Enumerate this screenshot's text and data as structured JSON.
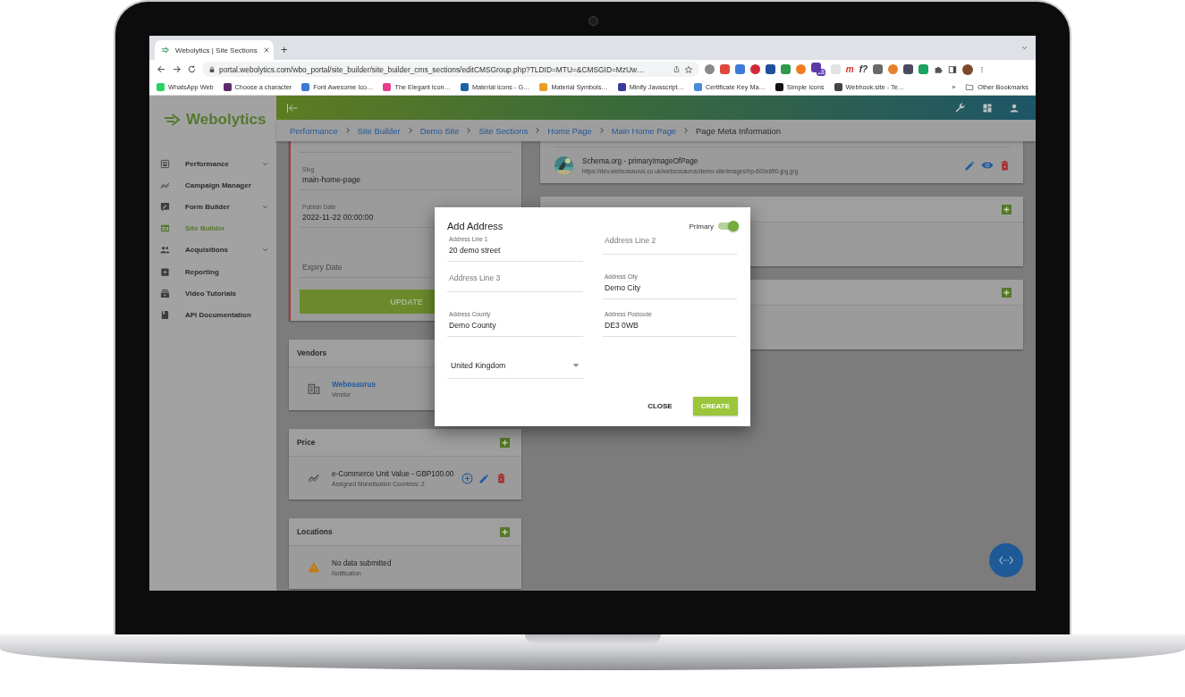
{
  "browser": {
    "tab": {
      "title": "Webolytics | Site Sections"
    },
    "new_tab": "+",
    "url": "portal.webolytics.com/wbo_portal/site_builder/site_builder_cms_sections/editCMSGroup.php?TLDID=MTU=&CMSGID=MzUw…",
    "extensions": [
      {
        "kind": "icon",
        "color": "#8a8a8a"
      },
      {
        "kind": "icon",
        "color": "#e0463c"
      },
      {
        "kind": "icon",
        "color": "#3b7bd6"
      },
      {
        "kind": "icon",
        "color": "#d2283a"
      },
      {
        "kind": "icon",
        "color": "#1f4f9a"
      },
      {
        "kind": "icon",
        "color": "#2e9a4a"
      },
      {
        "kind": "icon",
        "color": "#f07a22"
      },
      {
        "kind": "badge",
        "color": "#5b3aa8",
        "badge": "18"
      },
      {
        "kind": "icon",
        "color": "#e2e2e2"
      },
      {
        "kind": "text",
        "color": "#d8302c",
        "text": "m"
      },
      {
        "kind": "text",
        "color": "#333333",
        "text": "f?"
      },
      {
        "kind": "icon",
        "color": "#6a6a6a"
      },
      {
        "kind": "icon",
        "color": "#e8822a"
      },
      {
        "kind": "icon",
        "color": "#4a4a60"
      },
      {
        "kind": "icon",
        "color": "#1aa260"
      }
    ],
    "bookmarks": [
      {
        "label": "WhatsApp Web",
        "color": "#25d366"
      },
      {
        "label": "Choose a character",
        "color": "#5a2a6a"
      },
      {
        "label": "Font Awesome Ico…",
        "color": "#3b7bd6"
      },
      {
        "label": "The Elegant Icon…",
        "color": "#e83e8c"
      },
      {
        "label": "Material icons - G…",
        "color": "#1f5fa8"
      },
      {
        "label": "Material Symbols…",
        "color": "#e8a020"
      },
      {
        "label": "Minify Javascript…",
        "color": "#3a3a9a"
      },
      {
        "label": "Certificate Key Ma…",
        "color": "#4a8ad8"
      },
      {
        "label": "Simple Icons",
        "color": "#111111"
      },
      {
        "label": "Webhook.site - Te…",
        "color": "#444444"
      }
    ],
    "more_bookmarks": "»",
    "other_bookmarks": "Other Bookmarks"
  },
  "app": {
    "logo": "Webolytics",
    "sidebar": {
      "items": [
        {
          "label": "Performance",
          "selected": false,
          "expandable": true
        },
        {
          "label": "Campaign Manager",
          "selected": false,
          "expandable": false
        },
        {
          "label": "Form Builder",
          "selected": false,
          "expandable": true
        },
        {
          "label": "Site Builder",
          "selected": true,
          "expandable": false
        },
        {
          "label": "Acquisitions",
          "selected": false,
          "expandable": true
        },
        {
          "label": "Reporting",
          "selected": false,
          "expandable": false
        },
        {
          "label": "Video Tutorials",
          "selected": false,
          "expandable": false
        },
        {
          "label": "API Documentation",
          "selected": false,
          "expandable": false
        }
      ]
    },
    "breadcrumbs": [
      {
        "label": "Performance",
        "current": false
      },
      {
        "label": "Site Builder",
        "current": false
      },
      {
        "label": "Demo Site",
        "current": false
      },
      {
        "label": "Site Sections",
        "current": false
      },
      {
        "label": "Home Page",
        "current": false
      },
      {
        "label": "Main Home Page",
        "current": false
      },
      {
        "label": "Page Meta Information",
        "current": true
      }
    ],
    "page_form": {
      "fields": [
        {
          "label": "Slug",
          "value": "main-home-page"
        },
        {
          "label": "Publish Date",
          "value": "2022-11-22 00:00:00"
        },
        {
          "placeholder": "Expiry Date"
        }
      ],
      "button": "UPDATE"
    },
    "left_cards": [
      {
        "title": "Vendors",
        "item": {
          "kind": "vendor",
          "title": "Webosaurus",
          "subtitle": "Vendor"
        }
      },
      {
        "title": "Price",
        "add_button": true,
        "item": {
          "kind": "price",
          "title": "e-Commerce Unit Value - GBP100.00",
          "subtitle": "Assigned Monetisation Countries: 2"
        }
      },
      {
        "title": "Locations",
        "add_button": true,
        "item": {
          "kind": "notice",
          "title": "No data submitted",
          "subtitle": "Notification"
        }
      }
    ],
    "schema_item": {
      "title": "Schema.org - primaryImageOfPage",
      "subtitle": "https://dev.websosaurus.co.uk/websosaurus/demo-site/images/hp-600x690-jpg.jpg"
    },
    "right_cards": [
      {
        "add_button": true
      },
      {
        "add_button": true
      }
    ]
  },
  "dialog": {
    "title": "Add Address",
    "primary": {
      "label": "Primary",
      "on": true
    },
    "fields": [
      {
        "label": "Address Line 1",
        "value": "20 demo street"
      },
      {
        "placeholder": "Address Line 2"
      },
      {
        "placeholder": "Address Line 3"
      },
      {
        "label": "Address City",
        "value": "Demo City"
      },
      {
        "label": "Address County",
        "value": "Demo County"
      },
      {
        "label": "Address Postcode",
        "value": "DE3 0WB"
      }
    ],
    "country": {
      "value": "United Kingdom"
    },
    "buttons": [
      {
        "label": "CLOSE",
        "kind": "text"
      },
      {
        "label": "CREATE",
        "kind": "primary"
      }
    ]
  }
}
